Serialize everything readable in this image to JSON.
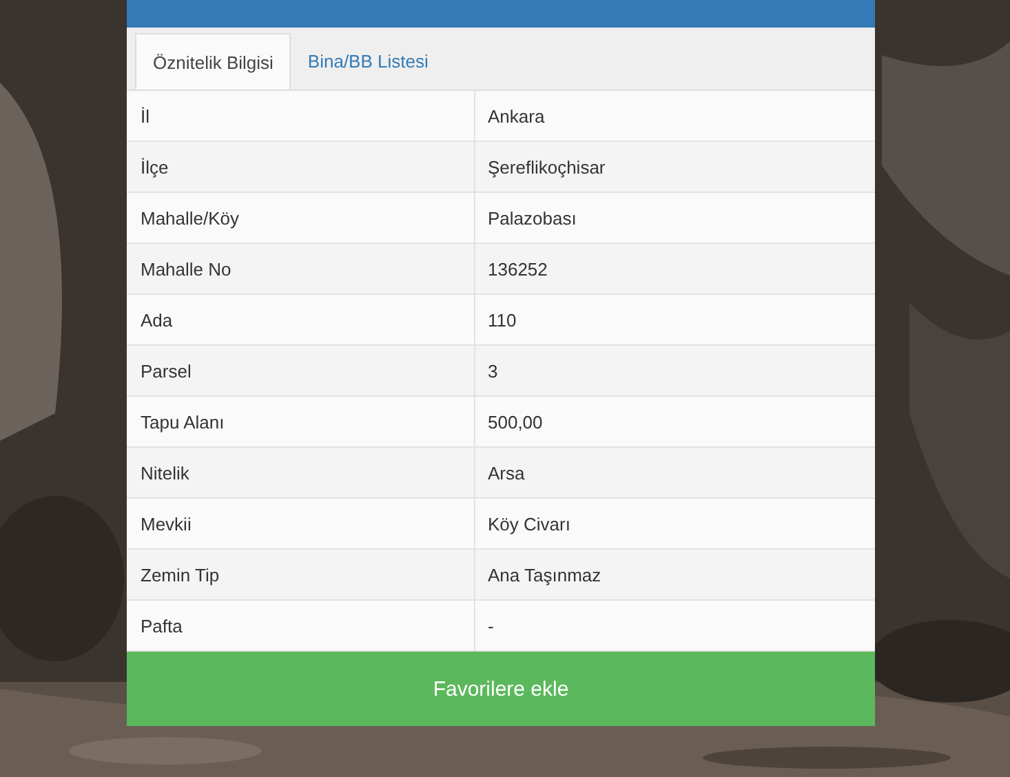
{
  "tabs": [
    {
      "label": "Öznitelik Bilgisi",
      "selected": true
    },
    {
      "label": "Bina/BB Listesi",
      "selected": false
    }
  ],
  "rows": [
    {
      "label": "İl",
      "value": "Ankara"
    },
    {
      "label": "İlçe",
      "value": "Şereflikoçhisar"
    },
    {
      "label": "Mahalle/Köy",
      "value": "Palazobası"
    },
    {
      "label": "Mahalle No",
      "value": "136252"
    },
    {
      "label": "Ada",
      "value": "110"
    },
    {
      "label": "Parsel",
      "value": "3"
    },
    {
      "label": "Tapu Alanı",
      "value": "500,00"
    },
    {
      "label": "Nitelik",
      "value": "Arsa"
    },
    {
      "label": "Mevkii",
      "value": "Köy Civarı"
    },
    {
      "label": "Zemin Tip",
      "value": "Ana Taşınmaz"
    },
    {
      "label": "Pafta",
      "value": "-"
    }
  ],
  "button": "Favorilere ekle"
}
